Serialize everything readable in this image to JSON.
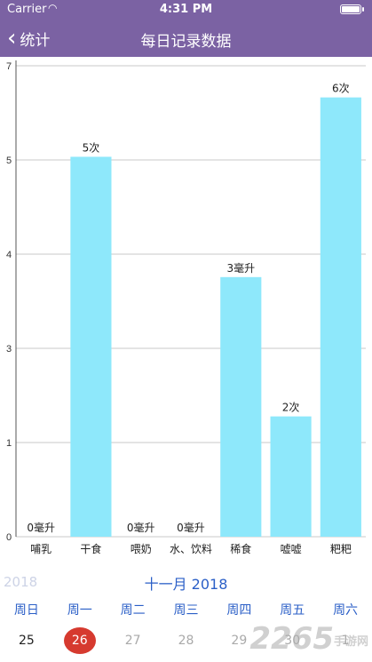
{
  "status_bar": {
    "carrier": "Carrier",
    "time": "4:31 PM",
    "battery_level": 1.0
  },
  "nav": {
    "back_label": "统计",
    "title": "每日记录数据"
  },
  "colors": {
    "nav_bg": "#7b62a3",
    "bar": "#8ee8fb",
    "accent": "#2b5fc7",
    "today": "#d63a2f"
  },
  "chart_data": {
    "type": "bar",
    "categories": [
      "哺乳",
      "干食",
      "喂奶",
      "水、饮料",
      "稀食",
      "嘘嘘",
      "粑粑"
    ],
    "values": [
      0,
      4.8,
      0,
      0,
      3.28,
      1.52,
      5.55
    ],
    "data_labels": [
      "0毫升",
      "5次",
      "0毫升",
      "0毫升",
      "3毫升",
      "2次",
      "6次"
    ],
    "yticks": [
      "0",
      "1",
      "3",
      "4",
      "5",
      "7"
    ],
    "ylim": [
      0,
      5.95
    ],
    "grid": true
  },
  "calendar": {
    "prev_year_label": "2018",
    "month_label": "十一月 2018",
    "weekdays": [
      "周日",
      "周一",
      "周二",
      "周三",
      "周四",
      "周五",
      "周六"
    ],
    "days": [
      "25",
      "26",
      "27",
      "28",
      "29",
      "30",
      "1"
    ],
    "selected_day": "26"
  },
  "watermark": {
    "text": "2265",
    "sub": "手游网"
  }
}
